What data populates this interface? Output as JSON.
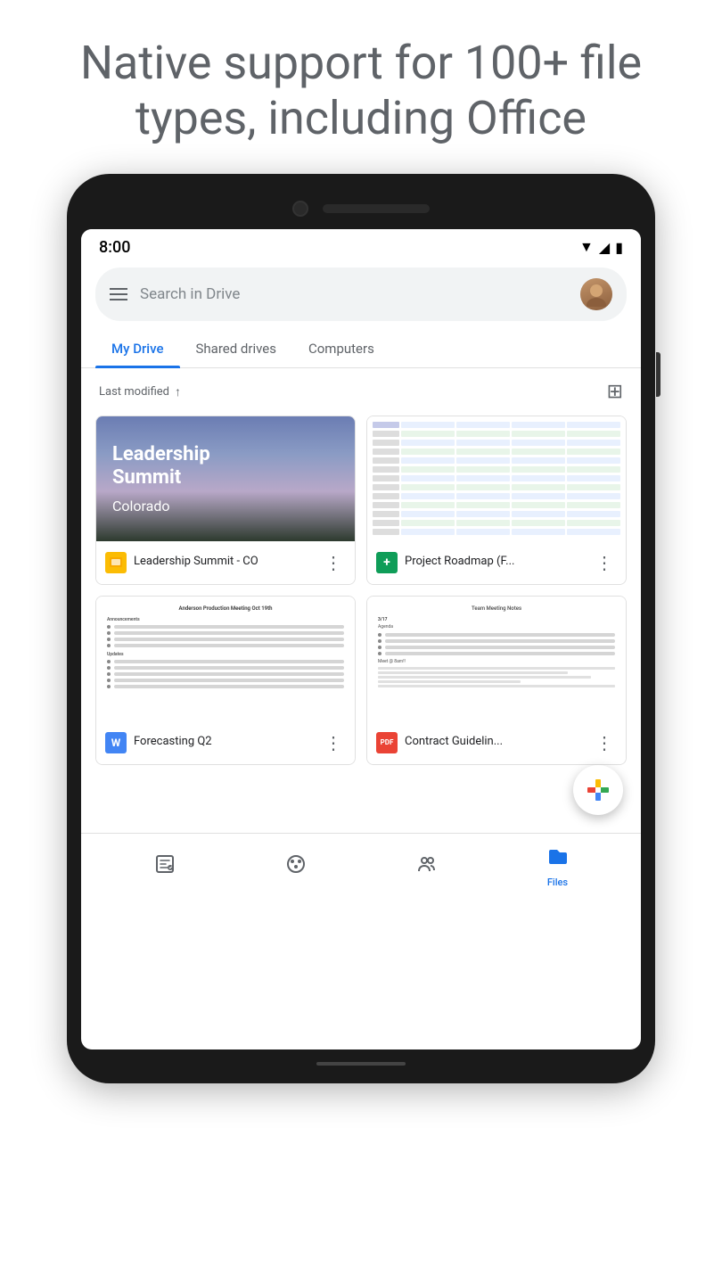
{
  "headline": {
    "line1": "Native support for 100+ file",
    "line2": "types, including Office"
  },
  "status_bar": {
    "time": "8:00"
  },
  "search": {
    "placeholder": "Search in Drive"
  },
  "tabs": [
    {
      "label": "My Drive",
      "active": true
    },
    {
      "label": "Shared drives",
      "active": false
    },
    {
      "label": "Computers",
      "active": false
    }
  ],
  "sort": {
    "label": "Last modified",
    "direction": "↑"
  },
  "files": [
    {
      "name": "Leadership Summit - CO",
      "icon_type": "slides",
      "icon_label": "▬"
    },
    {
      "name": "Project Roadmap (F...",
      "icon_type": "sheets",
      "icon_label": "+"
    },
    {
      "name": "Forecasting Q2",
      "icon_type": "docs",
      "icon_label": "W"
    },
    {
      "name": "Contract Guidelin...",
      "icon_type": "pdf",
      "icon_label": "PDF"
    }
  ],
  "bottom_nav": [
    {
      "icon": "☑",
      "label": "",
      "active": false,
      "name": "suggested-tab"
    },
    {
      "icon": "⊙",
      "label": "",
      "active": false,
      "name": "recents-tab"
    },
    {
      "icon": "👥",
      "label": "",
      "active": false,
      "name": "shared-tab"
    },
    {
      "icon": "📁",
      "label": "Files",
      "active": true,
      "name": "files-tab"
    }
  ]
}
